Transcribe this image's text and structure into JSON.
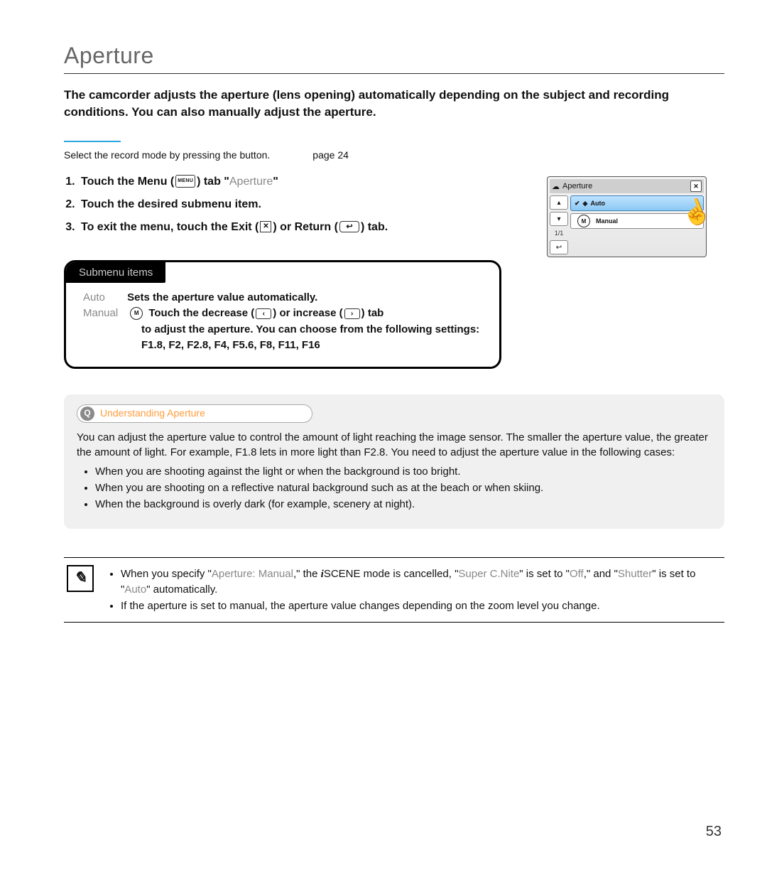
{
  "page": {
    "title": "Aperture",
    "intro": "The camcorder adjusts the aperture (lens opening) automatically depending on the subject and recording conditions. You can also manually adjust the aperture.",
    "page_number": "53"
  },
  "precheck": {
    "text": "Select the record mode by pressing the  button.",
    "page_ref": "page 24"
  },
  "steps": {
    "s1_a": "Touch the Menu (",
    "s1_menu": "MENU",
    "s1_b": ") tab ",
    "s1_quote_open": "  \"",
    "s1_link": "Aperture",
    "s1_quote_close": "\"",
    "s2": "Touch the desired submenu item.",
    "s3_a": "To exit the menu, touch the Exit (",
    "s3_b": ") or Return (",
    "s3_c": ") tab."
  },
  "lcd": {
    "title": "Aperture",
    "auto": "Auto",
    "manual": "Manual",
    "page": "1/1"
  },
  "submenu": {
    "header": "Submenu items",
    "auto_label": "Auto",
    "auto_text": "Sets the aperture value automatically.",
    "manual_label": "Manual",
    "manual_a": "Touch the decrease (",
    "manual_b": ") or increase (",
    "manual_c": ") tab",
    "manual_line2": "to adjust the aperture. You can choose from the following settings:",
    "manual_values": "F1.8, F2, F2.8, F4, F5.6, F8, F11, F16"
  },
  "understanding": {
    "pill": "Understanding Aperture",
    "para": "You can adjust the aperture value to control the amount of light reaching the image sensor. The smaller the aperture value, the greater the amount of light. For example, F1.8 lets in more light than F2.8. You need to adjust the aperture value in the following cases:",
    "b1": "When you are shooting against the light or when the background is too bright.",
    "b2": "When you are shooting on a reflective natural background such as at the beach or when skiing.",
    "b3": "When the background is overly dark (for example, scenery at night)."
  },
  "notes": {
    "n1_a": "When you specify \"",
    "n1_link1": "Aperture: Manual",
    "n1_b": ",\" the ",
    "n1_iscene": "SCENE",
    "n1_c": " mode is cancelled, \"",
    "n1_link2": "Super C.Nite",
    "n1_d": "\" is set to \"",
    "n1_link3": "Off",
    "n1_e": ",\" and \"",
    "n1_link4": "Shutter",
    "n1_f": "\" is set to \"",
    "n1_link5": "Auto",
    "n1_g": "\" automatically.",
    "n2": "If the aperture is set to manual, the aperture value changes depending on the zoom level you change."
  }
}
